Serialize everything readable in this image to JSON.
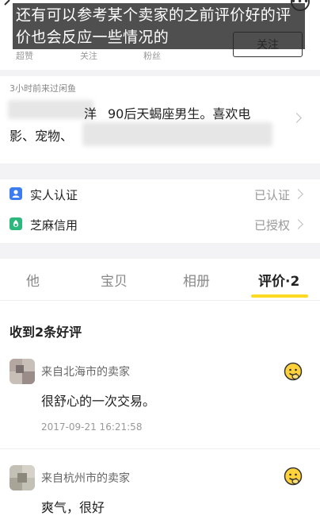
{
  "caption": "还有可以参考某个卖家的之前评价好的评价也会反应一些情况的",
  "header": {
    "follow_label": "关注",
    "more_label": "•••",
    "stats": [
      {
        "label": "超赞"
      },
      {
        "label": "关注"
      },
      {
        "label": "粉丝"
      }
    ]
  },
  "bio": {
    "visit_time": "3小时前来过闲鱼",
    "line1_visible": "90后天蝎座男生。喜欢电",
    "line2_visible": "影、宠物、",
    "line1_partial": "洋"
  },
  "verify": [
    {
      "label": "实人认证",
      "status": "已认证",
      "icon": "id-badge-icon",
      "color": "#3c7cf0"
    },
    {
      "label": "芝麻信用",
      "status": "已授权",
      "icon": "sesame-credit-icon",
      "color": "#2cb77c"
    }
  ],
  "tabs": [
    {
      "label": "他"
    },
    {
      "label": "宝贝"
    },
    {
      "label": "相册"
    },
    {
      "label": "评价·2",
      "active": true
    }
  ],
  "reviews": {
    "title": "收到2条好评",
    "items": [
      {
        "from": "来自北海市的卖家",
        "text": "很舒心的一次交易。",
        "time": "2017-09-21 16:21:58",
        "emoji": "happy-face-icon"
      },
      {
        "from": "来自杭州市的卖家",
        "text": "爽气，很好",
        "time": "",
        "emoji": "happy-face-icon"
      }
    ]
  },
  "colors": {
    "accent": "#ffda24",
    "text": "#222222",
    "muted": "#999999"
  }
}
